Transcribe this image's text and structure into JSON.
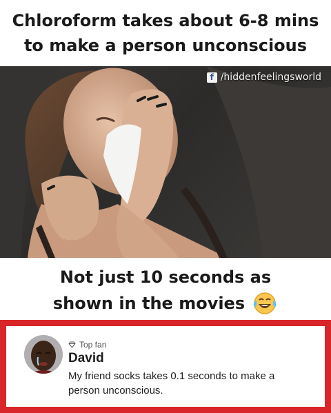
{
  "top_caption": {
    "line1": "Chloroform takes about 6-8 mins",
    "line2": "to make a person unconscious"
  },
  "photo": {
    "watermark_icon": "facebook-icon",
    "watermark_text": "/hiddenfeelingsworld"
  },
  "middle_caption": {
    "line1": "Not just 10 seconds as",
    "line2": "shown in the movies",
    "emoji_icon": "laughing-tears-emoji"
  },
  "comment": {
    "badge_icon": "diamond-badge-icon",
    "badge_label": "Top fan",
    "author": "David",
    "text": "My friend socks takes 0.1 seconds to make a person unconscious.",
    "border_color": "#d8262a"
  }
}
